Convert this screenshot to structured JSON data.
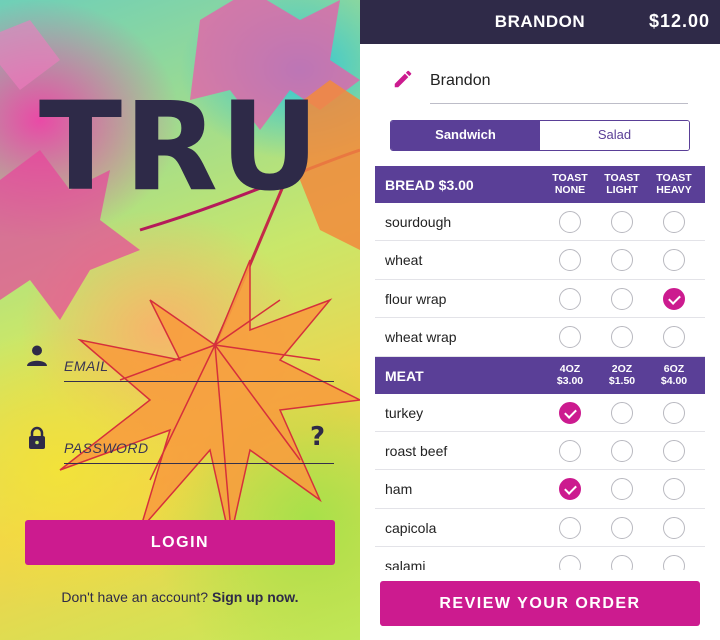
{
  "login": {
    "brand": "TRU",
    "email_placeholder": "EMAIL",
    "password_placeholder": "PASSWORD",
    "help_icon": "?",
    "login_label": "LOGIN",
    "signup_prefix": "Don't have an account?",
    "signup_link": "Sign up now."
  },
  "order": {
    "header_name": "BRANDON",
    "header_total": "$12.00",
    "name_value": "Brandon",
    "segments": [
      "Sandwich",
      "Salad"
    ],
    "selected_segment": "Sandwich",
    "bread": {
      "title": "BREAD $3.00",
      "columns": [
        [
          "TOAST",
          "NONE"
        ],
        [
          "TOAST",
          "LIGHT"
        ],
        [
          "TOAST",
          "HEAVY"
        ]
      ],
      "rows": [
        {
          "label": "sourdough",
          "selected": null
        },
        {
          "label": "wheat",
          "selected": null
        },
        {
          "label": "flour wrap",
          "selected": 2
        },
        {
          "label": "wheat wrap",
          "selected": null
        }
      ]
    },
    "meat": {
      "title": "MEAT",
      "columns": [
        [
          "4OZ",
          "$3.00"
        ],
        [
          "2OZ",
          "$1.50"
        ],
        [
          "6OZ",
          "$4.00"
        ]
      ],
      "rows": [
        {
          "label": "turkey",
          "selected": 0
        },
        {
          "label": "roast beef",
          "selected": null
        },
        {
          "label": "ham",
          "selected": 0
        },
        {
          "label": "capicola",
          "selected": null
        },
        {
          "label": "salami",
          "selected": null
        }
      ]
    },
    "review_label": "REVIEW YOUR ORDER"
  },
  "icons": {
    "user": "user-icon",
    "lock": "lock-icon",
    "help": "help-icon",
    "edit": "pencil-icon"
  },
  "colors": {
    "primary": "#cc1b8f",
    "purple": "#5a3f97",
    "dark": "#2f2a48"
  }
}
